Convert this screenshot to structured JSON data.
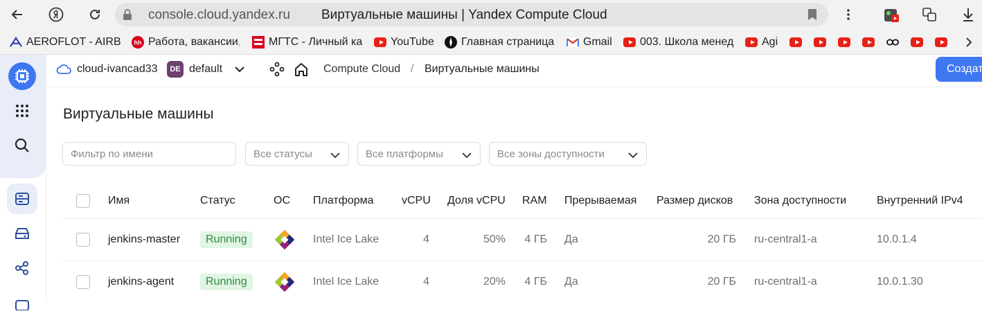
{
  "browser": {
    "url": "console.cloud.yandex.ru",
    "tab_title": "Виртуальные машины | Yandex Compute Cloud"
  },
  "bookmarks": [
    {
      "label": "AEROFLOT - AIRBUS",
      "icon": "aeroflot-icon"
    },
    {
      "label": "Работа, вакансии,",
      "icon": "hh-icon"
    },
    {
      "label": "МГТС - Личный ка",
      "icon": "mgts-icon"
    },
    {
      "label": "YouTube",
      "icon": "youtube-icon"
    },
    {
      "label": "Главная страница",
      "icon": "compass-icon"
    },
    {
      "label": "Gmail",
      "icon": "gmail-icon"
    },
    {
      "label": "003. Школа менед",
      "icon": "youtube-icon"
    },
    {
      "label": "Agi",
      "icon": "youtube-icon"
    }
  ],
  "header": {
    "cloud": "cloud-ivancad33",
    "folder_badge": "DE",
    "folder": "default",
    "service": "Compute Cloud",
    "separator": "/",
    "page": "Виртуальные машины",
    "create_button": "Создать"
  },
  "main": {
    "title": "Виртуальные машины",
    "filters": {
      "name_placeholder": "Фильтр по имени",
      "status": "Все статусы",
      "platform": "Все платформы",
      "zone": "Все зоны доступности"
    },
    "columns": [
      "Имя",
      "Статус",
      "ОС",
      "Платформа",
      "vCPU",
      "Доля vCPU",
      "RAM",
      "Прерываемая",
      "Размер дисков",
      "Зона доступности",
      "Внутренний IPv4"
    ],
    "rows": [
      {
        "name": "jenkins-master",
        "status": "Running",
        "platform": "Intel Ice Lake",
        "vcpu": "4",
        "vcpu_share": "50%",
        "ram": "4 ГБ",
        "preemptible": "Да",
        "disk": "20 ГБ",
        "zone": "ru-central1-a",
        "ipv4": "10.0.1.4"
      },
      {
        "name": "jenkins-agent",
        "status": "Running",
        "platform": "Intel Ice Lake",
        "vcpu": "4",
        "vcpu_share": "20%",
        "ram": "4 ГБ",
        "preemptible": "Да",
        "disk": "20 ГБ",
        "zone": "ru-central1-a",
        "ipv4": "10.0.1.30"
      }
    ]
  },
  "colors": {
    "accent": "#3e77f0",
    "running_bg": "#e0f5e3",
    "running_text": "#2f8a3f",
    "folder_badge": "#6e3f70"
  }
}
